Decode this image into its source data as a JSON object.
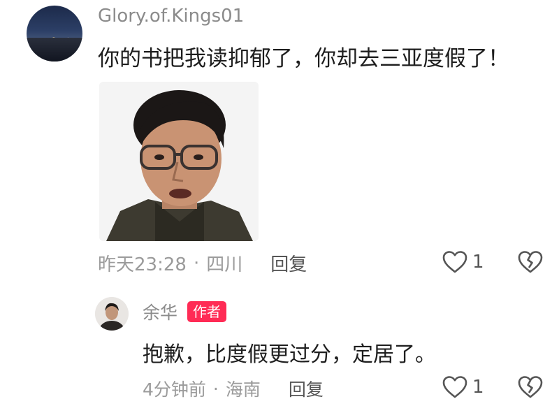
{
  "comment": {
    "username": "Glory.of.Kings01",
    "text": "你的书把我读抑郁了，你却去三亚度假了！",
    "time": "昨天23:28",
    "separator": "·",
    "location": "四川",
    "reply_label": "回复",
    "likes": "1",
    "sticker_icon": "sticker-face-image"
  },
  "reply": {
    "username": "余华",
    "badge": "作者",
    "text": "抱歉，比度假更过分，定居了。",
    "time": "4分钟前",
    "separator": "·",
    "location": "海南",
    "reply_label": "回复",
    "likes": "1"
  },
  "colors": {
    "badge": "#ff2b55",
    "meta_text": "#9b9b9b",
    "body_text": "#1e1e1e"
  },
  "icons": {
    "like": "heart-outline-icon",
    "dislike": "broken-heart-icon"
  }
}
